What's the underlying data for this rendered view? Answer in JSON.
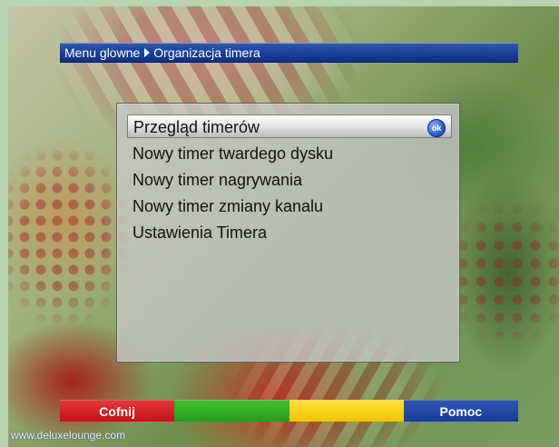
{
  "breadcrumb": {
    "parent": "Menu glowne",
    "current": "Organizacja timera"
  },
  "menu": {
    "items": [
      {
        "label": "Przegląd timerów",
        "selected": true
      },
      {
        "label": "Nowy timer twardego dysku",
        "selected": false
      },
      {
        "label": "Nowy timer nagrywania",
        "selected": false
      },
      {
        "label": "Nowy timer zmiany kanalu",
        "selected": false
      },
      {
        "label": "Ustawienia Timera",
        "selected": false
      }
    ],
    "ok_badge": "ok"
  },
  "color_buttons": {
    "red": "Cofnij",
    "green": "",
    "yellow": "",
    "blue": "Pomoc"
  },
  "watermark": "www.deluxelounge.com",
  "colors": {
    "header_blue": "#183c95",
    "button_red": "#c3121a",
    "button_green": "#279b1c",
    "button_yellow": "#f0c20a",
    "button_blue": "#183c95"
  }
}
